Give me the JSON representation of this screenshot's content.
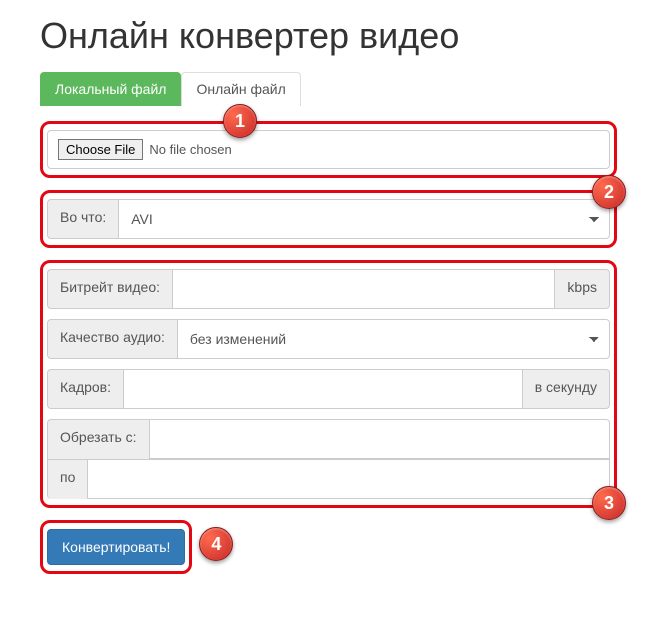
{
  "title": "Онлайн конвертер видео",
  "tabs": {
    "local": "Локальный файл",
    "online": "Онлайн файл"
  },
  "file": {
    "choose": "Choose File",
    "status": "No file chosen"
  },
  "format": {
    "label": "Во что:",
    "value": "AVI"
  },
  "bitrate": {
    "label": "Битрейт видео:",
    "unit": "kbps",
    "value": ""
  },
  "audio": {
    "label": "Качество аудио:",
    "value": "без изменений"
  },
  "frames": {
    "label": "Кадров:",
    "unit": "в секунду",
    "value": ""
  },
  "trim": {
    "from_label": "Обрезать с:",
    "to_label": "по",
    "from": "",
    "to": ""
  },
  "convert": "Конвертировать!",
  "annotations": {
    "1": "1",
    "2": "2",
    "3": "3",
    "4": "4"
  }
}
